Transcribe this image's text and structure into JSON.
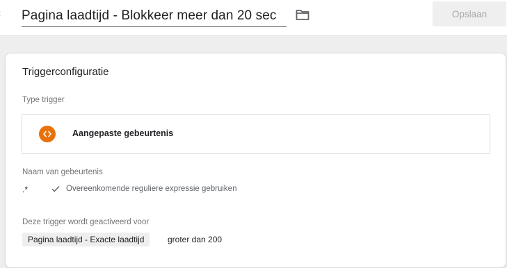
{
  "header": {
    "back_icon": "chevron-left-icon",
    "title": "Pagina laadtijd - Blokkeer meer dan 20 sec",
    "folder_icon": "folder-icon",
    "save_label": "Opslaan"
  },
  "trigger_config": {
    "heading": "Triggerconfiguratie",
    "type_label": "Type trigger",
    "type_value": "Aangepaste gebeurtenis",
    "type_icon": "code-brackets-icon",
    "type_icon_color": "#e8710a",
    "event_label": "Naam van gebeurtenis",
    "event_value": ".*",
    "regex_checked": true,
    "regex_label": "Overeenkomende reguliere expressie gebruiken",
    "fires_on_label": "Deze trigger wordt geactiveerd voor",
    "condition": {
      "variable": "Pagina laadtijd - Exacte laadtijd",
      "operator_value": "groter dan 200"
    }
  }
}
